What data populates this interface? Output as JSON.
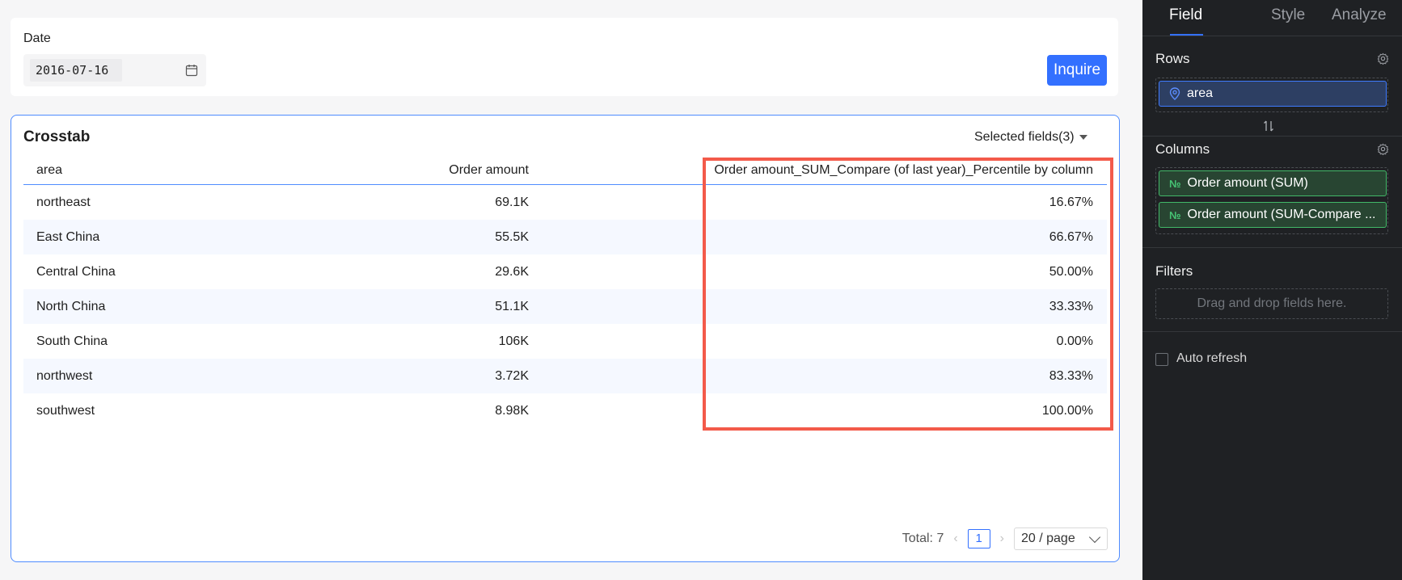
{
  "filter": {
    "label": "Date",
    "date_value": "2016-07-16",
    "inquire_label": "Inquire"
  },
  "crosstab": {
    "title": "Crosstab",
    "selected_fields": "Selected fields(3)",
    "columns": [
      "area",
      "Order amount",
      "Order amount_SUM_Compare (of last year)_Percentile by column"
    ],
    "rows": [
      [
        "northeast",
        "69.1K",
        "16.67%"
      ],
      [
        "East China",
        "55.5K",
        "66.67%"
      ],
      [
        "Central China",
        "29.6K",
        "50.00%"
      ],
      [
        "North China",
        "51.1K",
        "33.33%"
      ],
      [
        "South China",
        "106K",
        "0.00%"
      ],
      [
        "northwest",
        "3.72K",
        "83.33%"
      ],
      [
        "southwest",
        "8.98K",
        "100.00%"
      ]
    ],
    "pagination": {
      "total": "Total: 7",
      "current_page": "1",
      "page_size": "20 / page"
    }
  },
  "panel": {
    "tabs": [
      "Field",
      "Style",
      "Analyze"
    ],
    "active_tab": "Field",
    "rows_title": "Rows",
    "rows_fields": [
      "area"
    ],
    "columns_title": "Columns",
    "columns_fields": [
      "Order amount (SUM)",
      "Order amount (SUM-Compare ..."
    ],
    "filters_title": "Filters",
    "filters_hint": "Drag and drop fields here.",
    "auto_refresh_label": "Auto refresh"
  },
  "colors": {
    "accent": "#3370ff",
    "highlight": "#f35a4a",
    "panel_bg": "#1f2124",
    "dimension_pill": "#2d3f63",
    "measure_pill": "#284532"
  },
  "icons": [
    "calendar-icon",
    "caret-down-icon",
    "gear-icon",
    "location-pin-icon",
    "number-icon",
    "swap-icon",
    "chevron-left-icon",
    "chevron-right-icon",
    "chevron-down-icon"
  ]
}
